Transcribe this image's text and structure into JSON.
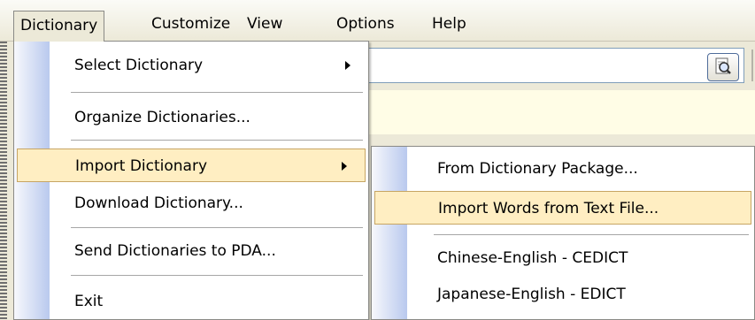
{
  "menubar": {
    "items": [
      {
        "label": "Dictionary",
        "active": true
      },
      {
        "label": "Customize"
      },
      {
        "label": "View"
      },
      {
        "label": "Options"
      },
      {
        "label": "Help"
      }
    ]
  },
  "dictionary_menu": {
    "items": [
      {
        "label": "Select Dictionary",
        "has_submenu": true
      },
      {
        "label": "Organize Dictionaries..."
      },
      {
        "label": "Import Dictionary",
        "has_submenu": true,
        "highlighted": true
      },
      {
        "label": "Download Dictionary..."
      },
      {
        "label": "Send Dictionaries to PDA..."
      },
      {
        "label": "Exit"
      }
    ]
  },
  "import_submenu": {
    "items": [
      {
        "label": "From Dictionary Package..."
      },
      {
        "label": "Import Words from Text File...",
        "highlighted": true
      },
      {
        "label": "Chinese-English - CEDICT"
      },
      {
        "label": "Japanese-English - EDICT"
      }
    ]
  },
  "colors": {
    "highlight": "#ffeec2",
    "highlight_border": "#c7a563",
    "gutter": "#b9c9ee"
  },
  "icons": [
    "chevron-down-icon",
    "search-icon",
    "submenu-arrow-icon"
  ]
}
